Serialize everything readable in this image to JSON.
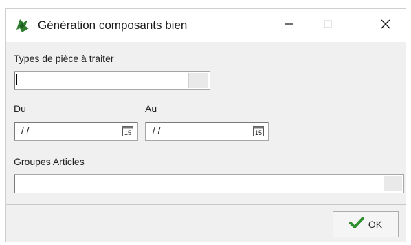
{
  "window": {
    "title": "Génération composants bien",
    "icon": "app-icon",
    "controls": {
      "minimize": "minimize-icon",
      "maximize": "maximize-icon",
      "close": "close-icon"
    }
  },
  "form": {
    "types_piece": {
      "label": "Types de pièce à traiter",
      "value": ""
    },
    "du": {
      "label": "Du",
      "value": "/ /",
      "calendar_icon_text": "15"
    },
    "au": {
      "label": "Au",
      "value": "/ /",
      "calendar_icon_text": "15"
    },
    "groupes_articles": {
      "label": "Groupes Articles",
      "value": ""
    }
  },
  "footer": {
    "ok_label": "OK",
    "ok_icon": "checkmark-icon"
  },
  "colors": {
    "accent_green": "#2f8f2f",
    "window_bg": "#f0f0f0"
  }
}
